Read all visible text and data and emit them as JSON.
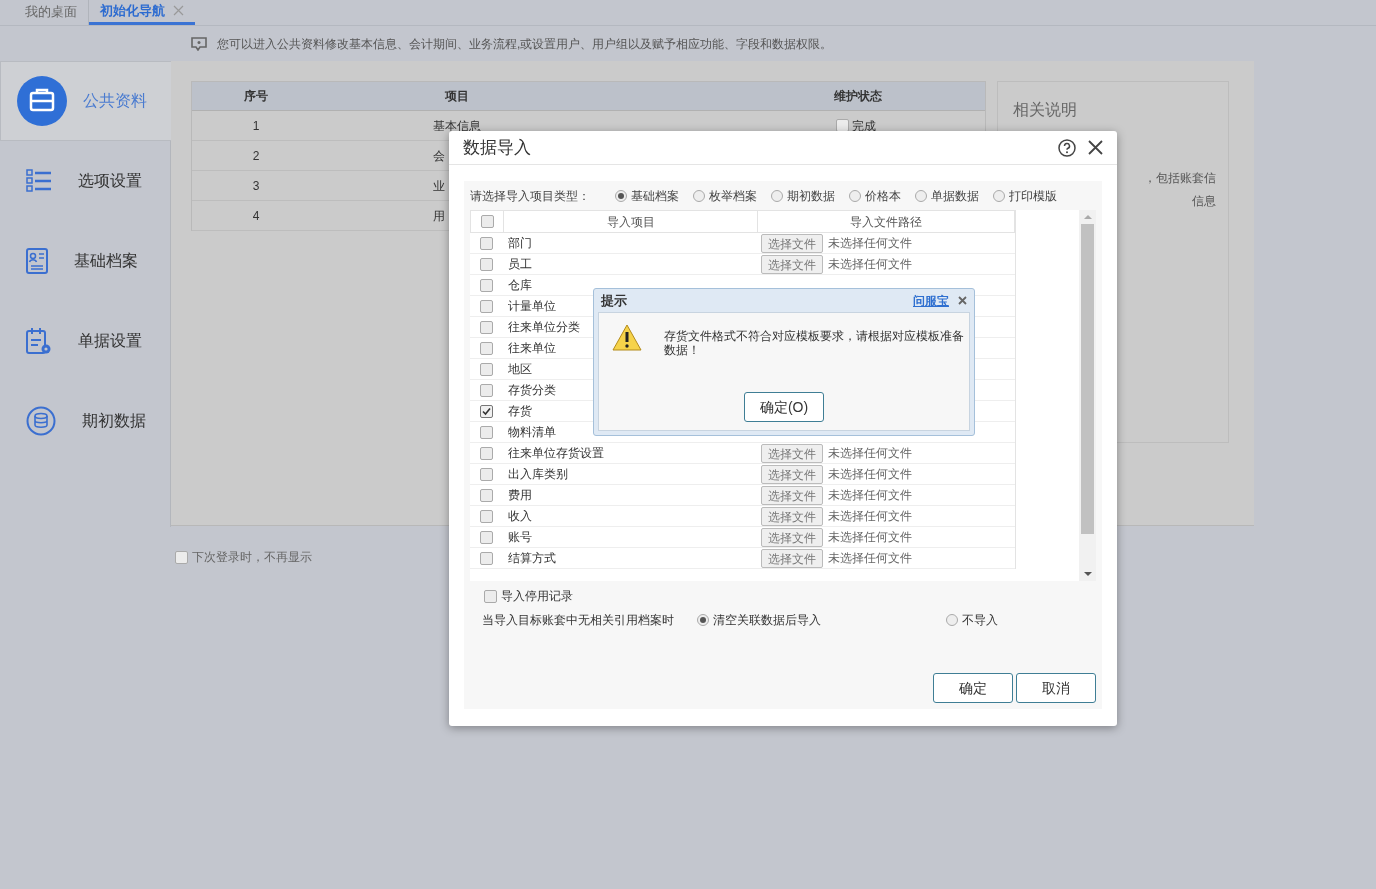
{
  "tabs": [
    {
      "label": "我的桌面",
      "selected": false,
      "closable": false
    },
    {
      "label": "初始化导航",
      "selected": true,
      "closable": true
    }
  ],
  "banner": "您可以进入公共资料修改基本信息、会计期间、业务流程,或设置用户、用户组以及赋予相应功能、字段和数据权限。",
  "sidebar": {
    "items": [
      {
        "label": "公共资料",
        "kind": "briefcase",
        "selected": true
      },
      {
        "label": "选项设置",
        "kind": "checklist",
        "selected": false
      },
      {
        "label": "基础档案",
        "kind": "profile",
        "selected": false
      },
      {
        "label": "单据设置",
        "kind": "doc-settings",
        "selected": false
      },
      {
        "label": "期初数据",
        "kind": "database",
        "selected": false
      }
    ]
  },
  "table": {
    "columns": [
      "序号",
      "项目",
      "维护状态"
    ],
    "rows": [
      {
        "index": "1",
        "item": "基本信息",
        "status": "完成",
        "done": false
      },
      {
        "index": "2",
        "item": "会"
      },
      {
        "index": "3",
        "item": "业"
      },
      {
        "index": "4",
        "item": "用"
      }
    ]
  },
  "related": {
    "title": "相关说明",
    "lines": [
      "，包括账套信",
      "信息"
    ]
  },
  "dont_show": {
    "label": "下次登录时，不再显示",
    "checked": false
  },
  "dialog": {
    "title": "数据导入",
    "type_label": "请选择导入项目类型：",
    "types": [
      {
        "label": "基础档案",
        "selected": true
      },
      {
        "label": "枚举档案",
        "selected": false
      },
      {
        "label": "期初数据",
        "selected": false
      },
      {
        "label": "价格本",
        "selected": false
      },
      {
        "label": "单据数据",
        "selected": false
      },
      {
        "label": "打印模版",
        "selected": false
      }
    ],
    "columns": [
      "导入项目",
      "导入文件路径"
    ],
    "all_checked": false,
    "rows": [
      {
        "name": "部门",
        "checked": false,
        "file_button": "选择文件",
        "file_status": "未选择任何文件"
      },
      {
        "name": "员工",
        "checked": false,
        "file_button": "选择文件",
        "file_status": "未选择任何文件"
      },
      {
        "name": "仓库",
        "checked": false
      },
      {
        "name": "计量单位",
        "checked": false
      },
      {
        "name": "往来单位分类",
        "checked": false
      },
      {
        "name": "往来单位",
        "checked": false
      },
      {
        "name": "地区",
        "checked": false
      },
      {
        "name": "存货分类",
        "checked": false
      },
      {
        "name": "存货",
        "checked": true
      },
      {
        "name": "物料清单",
        "checked": false
      },
      {
        "name": "往来单位存货设置",
        "checked": false,
        "file_button": "选择文件",
        "file_status": "未选择任何文件"
      },
      {
        "name": "出入库类别",
        "checked": false,
        "file_button": "选择文件",
        "file_status": "未选择任何文件"
      },
      {
        "name": "费用",
        "checked": false,
        "file_button": "选择文件",
        "file_status": "未选择任何文件"
      },
      {
        "name": "收入",
        "checked": false,
        "file_button": "选择文件",
        "file_status": "未选择任何文件"
      },
      {
        "name": "账号",
        "checked": false,
        "file_button": "选择文件",
        "file_status": "未选择任何文件"
      },
      {
        "name": "结算方式",
        "checked": false,
        "file_button": "选择文件",
        "file_status": "未选择任何文件"
      }
    ],
    "import_disabled": {
      "label": "导入停用记录",
      "checked": false
    },
    "missing_label": "当导入目标账套中无相关引用档案时",
    "missing_options": [
      {
        "label": "清空关联数据后导入",
        "selected": true
      },
      {
        "label": "不导入",
        "selected": false
      }
    ],
    "buttons": [
      "确定",
      "取消"
    ]
  },
  "alert": {
    "title": "提示",
    "link": "问服宝",
    "message": "存货文件格式不符合对应模板要求，请根据对应模板准备数据！",
    "button": "确定(O)"
  }
}
